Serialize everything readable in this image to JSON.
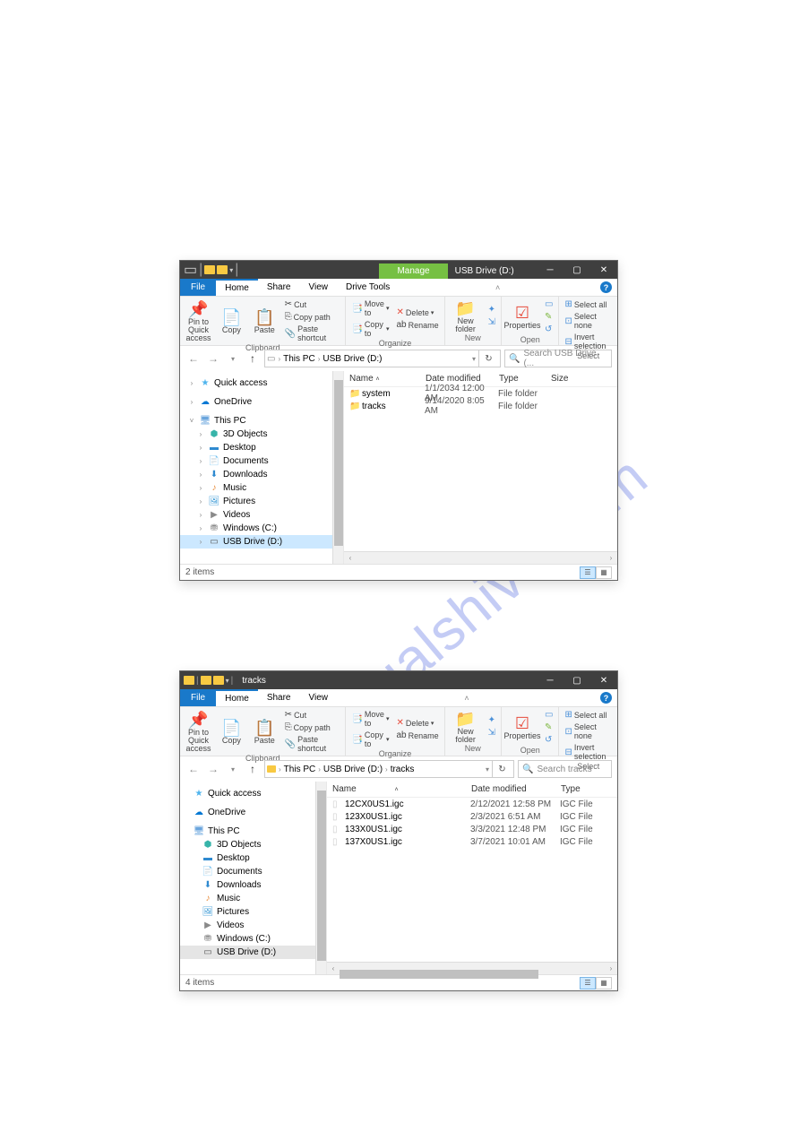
{
  "watermark_text": "manualshive.com",
  "window1": {
    "contextual_tab_label": "Manage",
    "title": "USB Drive (D:)",
    "menu": {
      "file": "File",
      "home": "Home",
      "share": "Share",
      "view": "View",
      "drive_tools": "Drive Tools"
    },
    "ribbon": {
      "pin": "Pin to Quick access",
      "copy": "Copy",
      "paste": "Paste",
      "cut": "Cut",
      "copy_path": "Copy path",
      "paste_shortcut": "Paste shortcut",
      "clipboard_label": "Clipboard",
      "move_to": "Move to",
      "copy_to": "Copy to",
      "delete": "Delete",
      "rename": "Rename",
      "organize_label": "Organize",
      "new_folder": "New folder",
      "new_label": "New",
      "properties": "Properties",
      "open_label": "Open",
      "select_all": "Select all",
      "select_none": "Select none",
      "invert_selection": "Invert selection",
      "select_label": "Select"
    },
    "breadcrumb": {
      "seg1": "This PC",
      "seg2": "USB Drive (D:)"
    },
    "search_placeholder": "Search USB Drive (...",
    "navpane": {
      "quick_access": "Quick access",
      "onedrive": "OneDrive",
      "this_pc": "This PC",
      "objects3d": "3D Objects",
      "desktop": "Desktop",
      "documents": "Documents",
      "downloads": "Downloads",
      "music": "Music",
      "pictures": "Pictures",
      "videos": "Videos",
      "windows_c": "Windows (C:)",
      "usb_d": "USB Drive (D:)"
    },
    "columns": {
      "name": "Name",
      "date": "Date modified",
      "type": "Type",
      "size": "Size"
    },
    "rows": [
      {
        "name": "system",
        "date": "1/1/2034 12:00 AM",
        "type": "File folder"
      },
      {
        "name": "tracks",
        "date": "9/14/2020 8:05 AM",
        "type": "File folder"
      }
    ],
    "status": "2 items"
  },
  "window2": {
    "title": "tracks",
    "menu": {
      "file": "File",
      "home": "Home",
      "share": "Share",
      "view": "View"
    },
    "ribbon": {
      "pin": "Pin to Quick access",
      "copy": "Copy",
      "paste": "Paste",
      "cut": "Cut",
      "copy_path": "Copy path",
      "paste_shortcut": "Paste shortcut",
      "clipboard_label": "Clipboard",
      "move_to": "Move to",
      "copy_to": "Copy to",
      "delete": "Delete",
      "rename": "Rename",
      "organize_label": "Organize",
      "new_folder": "New folder",
      "new_label": "New",
      "properties": "Properties",
      "open_label": "Open",
      "select_all": "Select all",
      "select_none": "Select none",
      "invert_selection": "Invert selection",
      "select_label": "Select"
    },
    "breadcrumb": {
      "seg1": "This PC",
      "seg2": "USB Drive (D:)",
      "seg3": "tracks"
    },
    "search_placeholder": "Search tracks",
    "navpane": {
      "quick_access": "Quick access",
      "onedrive": "OneDrive",
      "this_pc": "This PC",
      "objects3d": "3D Objects",
      "desktop": "Desktop",
      "documents": "Documents",
      "downloads": "Downloads",
      "music": "Music",
      "pictures": "Pictures",
      "videos": "Videos",
      "windows_c": "Windows (C:)",
      "usb_d": "USB Drive (D:)"
    },
    "columns": {
      "name": "Name",
      "date": "Date modified",
      "type": "Type"
    },
    "rows": [
      {
        "name": "12CX0US1.igc",
        "date": "2/12/2021 12:58 PM",
        "type": "IGC File"
      },
      {
        "name": "123X0US1.igc",
        "date": "2/3/2021 6:51 AM",
        "type": "IGC File"
      },
      {
        "name": "133X0US1.igc",
        "date": "3/3/2021 12:48 PM",
        "type": "IGC File"
      },
      {
        "name": "137X0US1.igc",
        "date": "3/7/2021 10:01 AM",
        "type": "IGC File"
      }
    ],
    "status": "4 items"
  }
}
